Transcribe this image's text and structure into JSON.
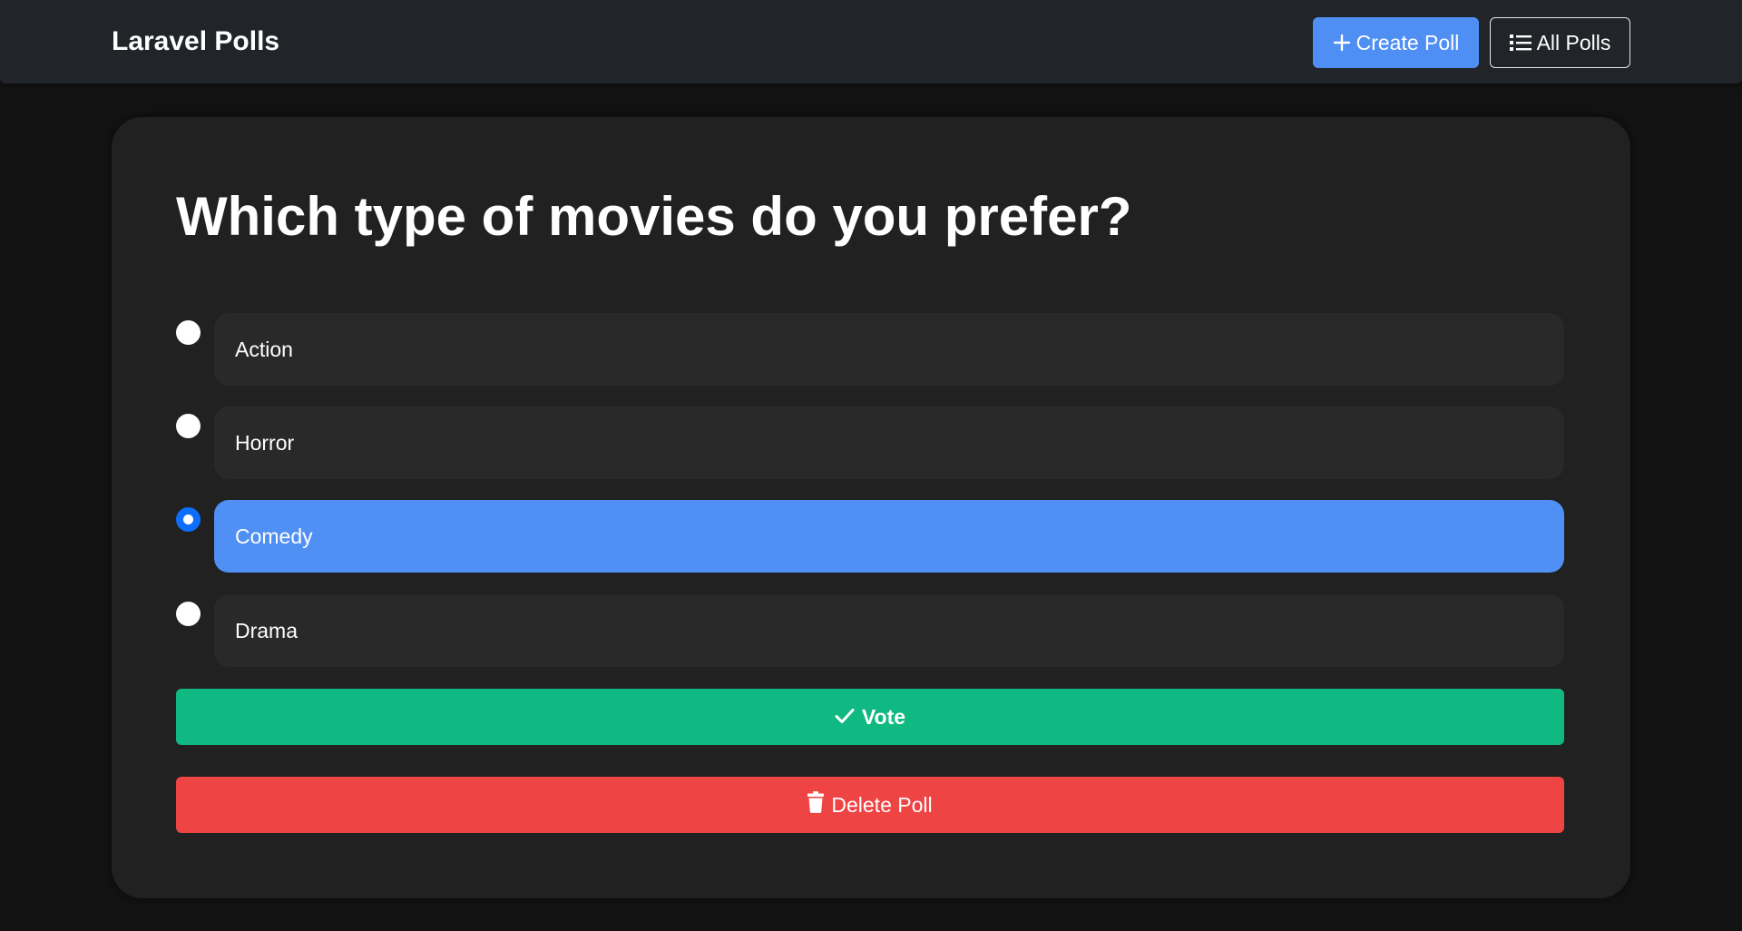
{
  "header": {
    "brand": "Laravel Polls",
    "create_label": "Create Poll",
    "create_icon": "plus-icon",
    "all_label": "All Polls",
    "all_icon": "list-icon"
  },
  "poll": {
    "question": "Which type of movies do you prefer?",
    "options": [
      {
        "label": "Action",
        "selected": false
      },
      {
        "label": "Horror",
        "selected": false
      },
      {
        "label": "Comedy",
        "selected": true
      },
      {
        "label": "Drama",
        "selected": false
      }
    ],
    "vote_label": "Vote",
    "vote_icon": "check-icon",
    "delete_label": "Delete Poll",
    "delete_icon": "trash-icon"
  },
  "colors": {
    "page_bg": "#131313",
    "navbar_bg": "#212429",
    "card_bg": "#212121",
    "option_bg": "#292929",
    "primary": "#4f8ff3",
    "radio_checked": "#0d6efd",
    "success": "#10b981",
    "danger": "#ef4444"
  }
}
